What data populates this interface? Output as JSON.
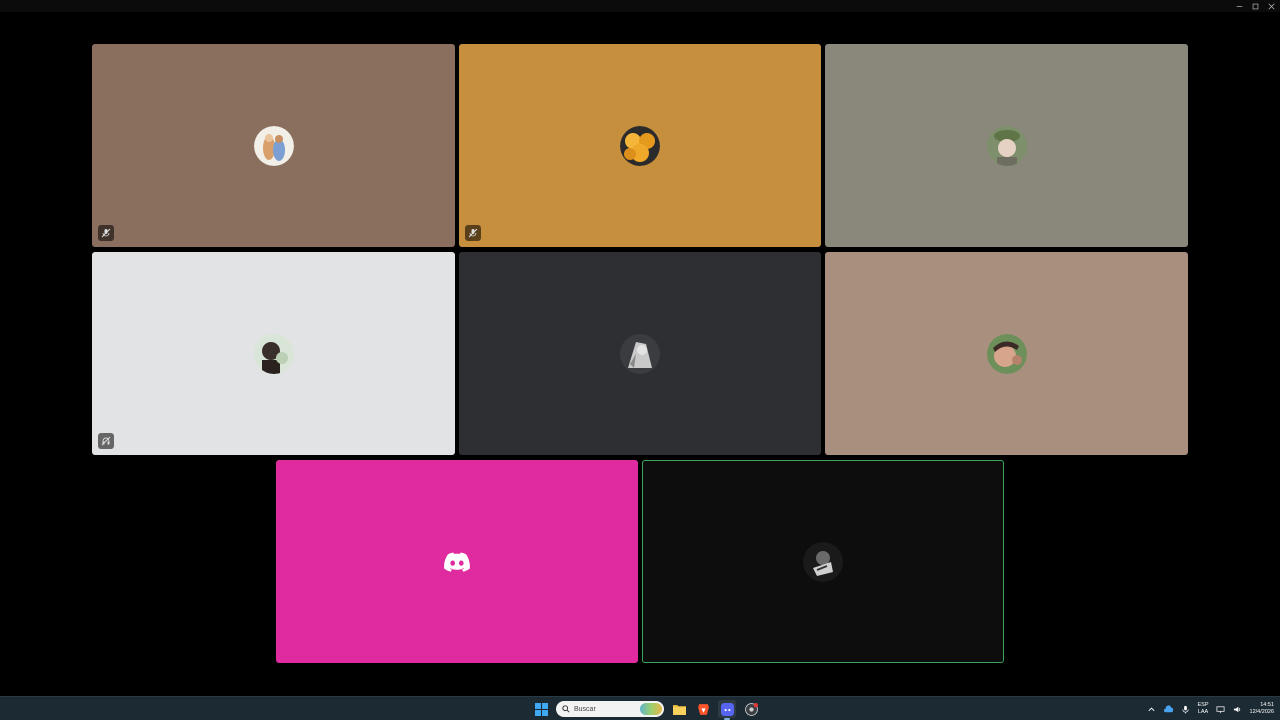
{
  "window": {
    "controls": [
      "minimize-icon",
      "maximize-icon",
      "close-icon"
    ]
  },
  "participants": [
    {
      "id": "p1",
      "tile_color": "#8a6f5f",
      "status": "mic-muted-icon",
      "avatar_colors": [
        "#f2efe8",
        "#d9a06b",
        "#7b9fd2"
      ]
    },
    {
      "id": "p2",
      "tile_color": "#c68f3d",
      "status": "mic-muted-icon",
      "avatar_colors": [
        "#f3b53a",
        "#e69a1d",
        "#2b2b2b"
      ]
    },
    {
      "id": "p3",
      "tile_color": "#8a877b",
      "status": null,
      "avatar_colors": [
        "#7d8f6b",
        "#e6d2c4",
        "#5f7447"
      ]
    },
    {
      "id": "p4",
      "tile_color": "#e2e3e4",
      "status": "deafened-icon",
      "avatar_colors": [
        "#d9e6d7",
        "#3a2f2a",
        "#bcd0b6"
      ]
    },
    {
      "id": "p5",
      "tile_color": "#2e2f33",
      "status": null,
      "avatar_colors": [
        "#3a3c40",
        "#c9c9c9",
        "#e3e3e3"
      ]
    },
    {
      "id": "p6",
      "tile_color": "#a88f7e",
      "status": null,
      "avatar_colors": [
        "#6d8f5a",
        "#d7a58b",
        "#3b2a26"
      ]
    },
    {
      "id": "p7",
      "tile_color": "#df2b9f",
      "status": null,
      "avatar_colors": null,
      "is_default_avatar": true
    },
    {
      "id": "p8",
      "tile_color": "#0d0d0d",
      "status": null,
      "avatar_colors": [
        "#1a1a1a",
        "#cfcfcf",
        "#6a6a6a"
      ],
      "speaking": true,
      "speaking_color": "#3ba55d"
    }
  ],
  "taskbar": {
    "search_placeholder": "Buscar",
    "pinned": [
      "windows-start-icon",
      "file-explorer-icon",
      "brave-browser-icon",
      "discord-icon",
      "chrome-icon"
    ],
    "tray": {
      "language_top": "ESP",
      "language_bottom": "LAA",
      "time": "14:51",
      "date": "12/4/2026"
    }
  }
}
